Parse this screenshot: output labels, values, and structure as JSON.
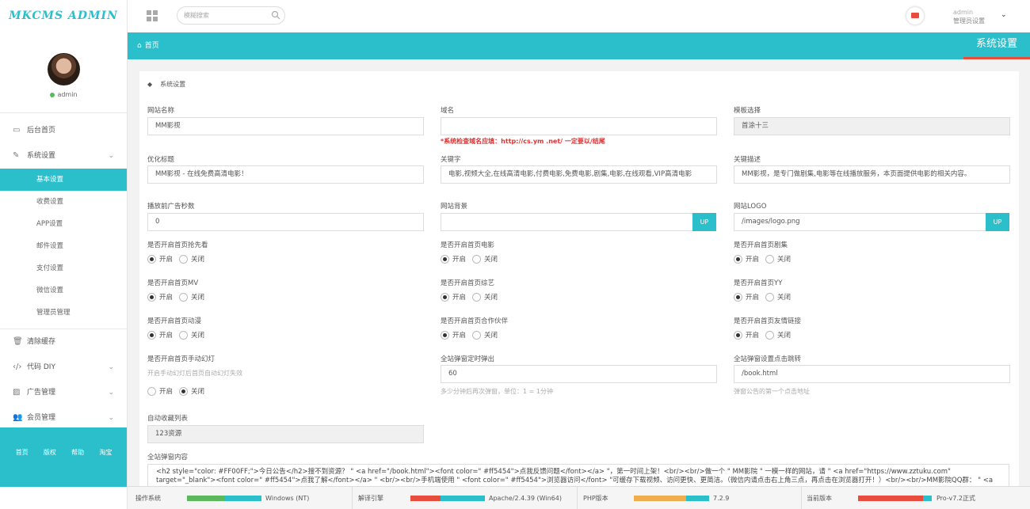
{
  "app": {
    "logo": "MKCMS ADMIN"
  },
  "profile": {
    "name": "admin"
  },
  "sidebar": {
    "items": [
      {
        "label": "后台首页",
        "icon": "laptop-icon"
      },
      {
        "label": "系统设置",
        "icon": "wrench-icon"
      },
      {
        "label": "清除缓存",
        "icon": "trash-icon"
      },
      {
        "label": "代码 DIY",
        "icon": "code-icon"
      },
      {
        "label": "广告管理",
        "icon": "image-icon"
      },
      {
        "label": "会员管理",
        "icon": "users-icon"
      }
    ],
    "sub_items": [
      "基本设置",
      "收费设置",
      "APP设置",
      "邮件设置",
      "支付设置",
      "微信设置",
      "管理员管理"
    ],
    "footer_links": [
      "首页",
      "版权",
      "帮助",
      "淘宝"
    ]
  },
  "topbar": {
    "search_placeholder": "模糊搜索",
    "user_name": "admin",
    "user_role": "管理员设置"
  },
  "header": {
    "breadcrumb": "首页",
    "page_title": "系统设置"
  },
  "form": {
    "panel_title": "系统设置",
    "site_name": {
      "label": "网站名称",
      "value": "MM影视"
    },
    "domain": {
      "label": "域名",
      "value": "",
      "warning": "*系统检查域名应填：http://cs.ym   .net/ 一定要以/结尾"
    },
    "template": {
      "label": "模板选择",
      "value": "首涂十三"
    },
    "seo_title": {
      "label": "优化标题",
      "value": "MM影视 - 在线免费高清电影！"
    },
    "keywords": {
      "label": "关键字",
      "value": "电影,视频大全,在线高清电影,付费电影,免费电影,剧集,电影,在线观看,VIP高清电影"
    },
    "description": {
      "label": "关键描述",
      "value": "MM影视，是专门做剧集,电影等在线播放服务，本页面提供电影的相关内容。"
    },
    "ad_seconds": {
      "label": "播放前广告秒数",
      "value": "0"
    },
    "background": {
      "label": "网站背景",
      "value": "",
      "button": "UP"
    },
    "site_logo": {
      "label": "网站LOGO",
      "value": "/images/logo.png",
      "button": "UP"
    },
    "radio_on": "开启",
    "radio_off": "关闭",
    "toggles": [
      {
        "label": "是否开启首页抢先看",
        "on": true
      },
      {
        "label": "是否开启首页电影",
        "on": true
      },
      {
        "label": "是否开启首页剧集",
        "on": true
      },
      {
        "label": "是否开启首页MV",
        "on": true
      },
      {
        "label": "是否开启首页综艺",
        "on": true
      },
      {
        "label": "是否开启首页YY",
        "on": true
      },
      {
        "label": "是否开启首页动漫",
        "on": true
      },
      {
        "label": "是否开启首页合作伙伴",
        "on": true
      },
      {
        "label": "是否开启首页友情链接",
        "on": true
      }
    ],
    "slider": {
      "label": "是否开启首页手动幻灯",
      "help": "开启手动幻灯后首页自动幻灯失效",
      "on": false
    },
    "popup_timer": {
      "label": "全站弹窗定时弹出",
      "value": "60",
      "help": "多少分钟后再次弹窗，单位：1 = 1分钟"
    },
    "popup_link": {
      "label": "全站弹窗设置点击跳转",
      "value": "/book.html",
      "help": "弹窗公告的第一个点击地址"
    },
    "auto_collect": {
      "label": "自动收藏列表",
      "value": "123资源"
    },
    "popup_content": {
      "label": "全站弹窗内容",
      "value": "<h2 style=\"color: #FF00FF;\">今日公告</h2>搜不到资源？ \" <a href=\"/book.html\"><font color=\" #ff5454\">点我反馈问题</font></a> \"，第一时间上架！<br/><br/>做一个 \" MM影院 \" 一模一样的网站，请 \" <a href=\"https://www.zztuku.com\" target=\"_blank\"><font color=\" #ff5454\">点我了解</font></a> \" <br/><br/>手机端使用 \" <font color=\" #ff5454\">浏览器访问</font> \"可缓存下载视频、访问更快、更简洁。（微信内请点击右上角三点，再点击在浏览器打开！）<br/><br/>MM影院QQ群： \" <a"
    }
  },
  "status": {
    "os_label": "操作系统",
    "os_value": "Windows (NT)",
    "engine_label": "解译引擎",
    "engine_value": "Apache/2.4.39 (Win64)",
    "php_label": "PHP版本",
    "php_value": "7.2.9",
    "version_label": "当前版本",
    "version_value": "Pro-v7.2正式"
  },
  "colors": {
    "accent": "#2bbfcc",
    "warning": "#e74c3c"
  }
}
